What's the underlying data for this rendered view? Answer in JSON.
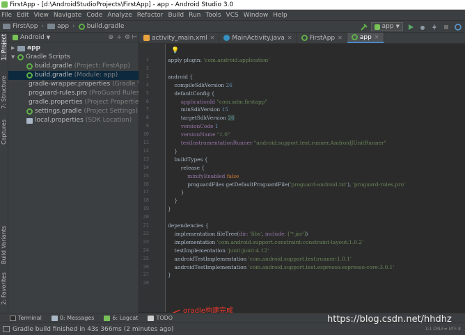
{
  "window": {
    "title": "FirstApp - [d:\\AndroidStudioProjects\\FirstApp] - app - Android Studio 3.0"
  },
  "menu": [
    "File",
    "Edit",
    "View",
    "Navigate",
    "Code",
    "Analyze",
    "Refactor",
    "Build",
    "Run",
    "Tools",
    "VCS",
    "Window",
    "Help"
  ],
  "breadcrumb": {
    "project": "FirstApp",
    "module": "app",
    "file": "build.gradle"
  },
  "toolbar": {
    "run_config": "app"
  },
  "left_tabs": {
    "project": "1: Project",
    "structure": "7: Structure",
    "captures": "Captures",
    "build_variants": "Build Variants",
    "favorites": "2: Favorites"
  },
  "project_panel": {
    "view": "Android",
    "tree": [
      {
        "label": "app",
        "sub": "",
        "kind": "folder",
        "level": 0
      },
      {
        "label": "Gradle Scripts",
        "sub": "",
        "kind": "gradle-folder",
        "level": 0
      },
      {
        "label": "build.gradle",
        "sub": "(Project: FirstApp)",
        "kind": "gradle",
        "level": 1
      },
      {
        "label": "build.gradle",
        "sub": "(Module: app)",
        "kind": "gradle",
        "level": 1
      },
      {
        "label": "gradle-wrapper.properties",
        "sub": "(Gradle Versi",
        "kind": "props",
        "level": 1
      },
      {
        "label": "proguard-rules.pro",
        "sub": "(ProGuard Rules for",
        "kind": "props",
        "level": 1
      },
      {
        "label": "gradle.properties",
        "sub": "(Project Properties)",
        "kind": "props",
        "level": 1
      },
      {
        "label": "settings.gradle",
        "sub": "(Project Settings)",
        "kind": "gradle",
        "level": 1
      },
      {
        "label": "local.properties",
        "sub": "(SDK Location)",
        "kind": "props",
        "level": 1
      }
    ]
  },
  "editor_tabs": [
    {
      "label": "activity_main.xml",
      "icon": "xml-icon",
      "active": false
    },
    {
      "label": "MainActivity.java",
      "icon": "java-class-icon",
      "active": false
    },
    {
      "label": "FirstApp",
      "icon": "gradle-icon",
      "active": false
    },
    {
      "label": "app",
      "icon": "gradle-icon",
      "active": true
    }
  ],
  "code": {
    "line_count": 28,
    "lines": [
      [
        [
          "apply plugin: ",
          "t"
        ],
        [
          "'com.android.application'",
          "s"
        ]
      ],
      [],
      [
        [
          "android {",
          "t"
        ]
      ],
      [
        [
          "    compileSdkVersion ",
          "t"
        ],
        [
          "26",
          "n"
        ]
      ],
      [
        [
          "    defaultConfig {",
          "t"
        ]
      ],
      [
        [
          "        applicationId ",
          "p"
        ],
        [
          "\"com.adm.firstapp\"",
          "s"
        ]
      ],
      [
        [
          "        minSdkVersion ",
          "t"
        ],
        [
          "15",
          "n"
        ]
      ],
      [
        [
          "        targetSdkVersion ",
          "t"
        ],
        [
          "26",
          "hl"
        ]
      ],
      [
        [
          "        versionCode ",
          "p"
        ],
        [
          "1",
          "n"
        ]
      ],
      [
        [
          "        versionName ",
          "p"
        ],
        [
          "\"1.0\"",
          "s"
        ]
      ],
      [
        [
          "        testInstrumentationRunner ",
          "p"
        ],
        [
          "\"android.support.test.runner.AndroidJUnitRunner\"",
          "s"
        ]
      ],
      [
        [
          "    }",
          "t"
        ]
      ],
      [
        [
          "    buildTypes {",
          "t"
        ]
      ],
      [
        [
          "        release {",
          "t"
        ]
      ],
      [
        [
          "            minifyEnabled ",
          "p"
        ],
        [
          "false",
          "k"
        ]
      ],
      [
        [
          "            proguardFiles getDefaultProguardFile(",
          "t"
        ],
        [
          "'proguard-android.txt'",
          "s"
        ],
        [
          "), ",
          "t"
        ],
        [
          "'proguard-rules.pro'",
          "s"
        ]
      ],
      [
        [
          "        }",
          "t"
        ]
      ],
      [
        [
          "    }",
          "t"
        ]
      ],
      [
        [
          "}",
          "t"
        ]
      ],
      [],
      [
        [
          "dependencies {",
          "t"
        ]
      ],
      [
        [
          "    implementation fileTree(",
          "t"
        ],
        [
          "dir: ",
          "p"
        ],
        [
          "'libs'",
          "s"
        ],
        [
          ", ",
          "t"
        ],
        [
          "include: ",
          "p"
        ],
        [
          "['*.jar']",
          "s"
        ],
        [
          ")",
          "t"
        ]
      ],
      [
        [
          "    implementation ",
          "t"
        ],
        [
          "'com.android.support.constraint:constraint-layout:1.0.2'",
          "s"
        ]
      ],
      [
        [
          "    testImplementation ",
          "t"
        ],
        [
          "'junit:junit:4.12'",
          "s"
        ]
      ],
      [
        [
          "    androidTestImplementation ",
          "t"
        ],
        [
          "'com.android.support.test:runner:1.0.1'",
          "s"
        ]
      ],
      [
        [
          "    androidTestImplementation ",
          "t"
        ],
        [
          "'com.android.support.test.espresso:espresso-core:3.0.1'",
          "s"
        ]
      ],
      [
        [
          "}",
          "t"
        ]
      ],
      []
    ]
  },
  "bottom_tabs": [
    {
      "label": "Terminal",
      "icon": "terminal-icon"
    },
    {
      "label": "0: Messages",
      "icon": "messages-icon"
    },
    {
      "label": "6: Logcat",
      "icon": "logcat-icon"
    },
    {
      "label": "TODO",
      "icon": "todo-icon"
    }
  ],
  "status": {
    "message": "Gradle build finished in 43s 366ms (2 minutes ago)",
    "right": "1:1  CRLF≠  UTF-8"
  },
  "annotation": {
    "text": "gradle构建完成",
    "color": "#e8382c"
  },
  "watermark": "https://blog.csdn.net/hhdhz"
}
